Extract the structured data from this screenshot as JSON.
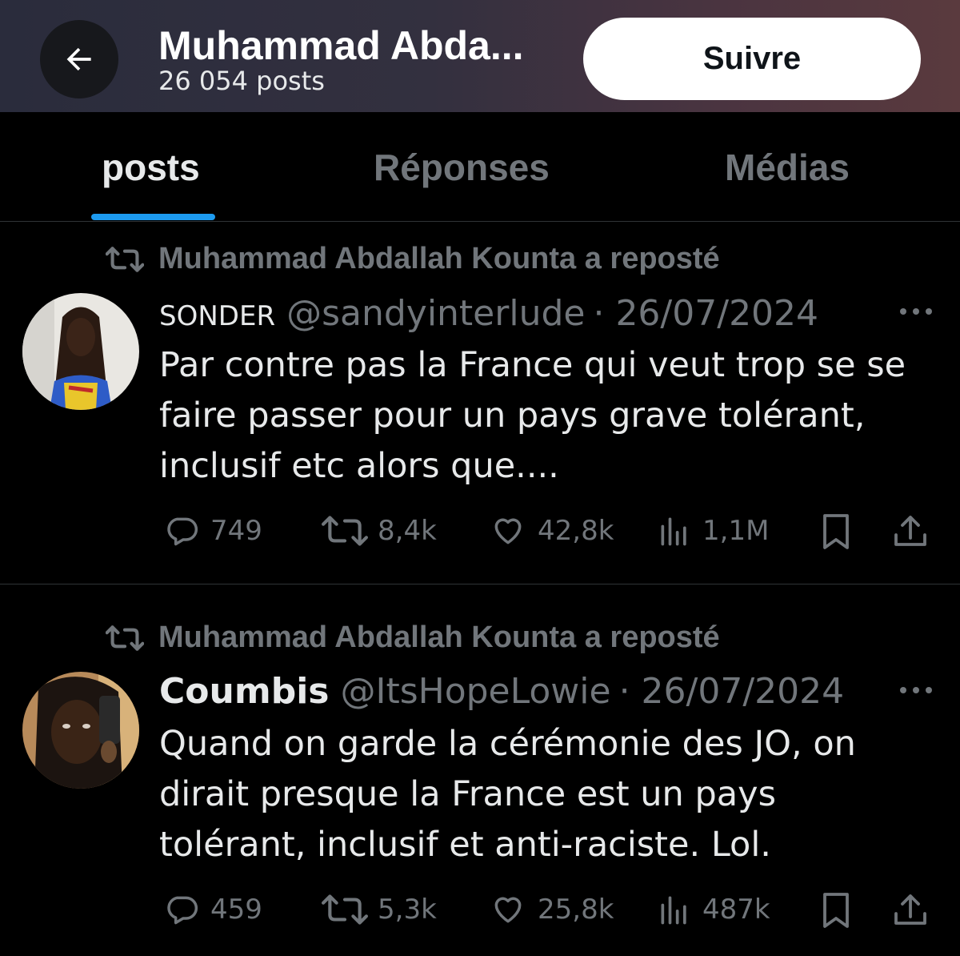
{
  "header": {
    "profile_name": "Muhammad Abda...",
    "post_count": "26 054 posts",
    "follow_label": "Suivre"
  },
  "tabs": [
    {
      "label": "posts",
      "active": true
    },
    {
      "label": "Réponses",
      "active": false
    },
    {
      "label": "Médias",
      "active": false
    }
  ],
  "accent_color": "#1d9bf0",
  "posts": [
    {
      "repost_text": "Muhammad Abdallah Kounta a reposté",
      "author_name": "SONDER",
      "handle": "@sandyinterlude",
      "date": "· 26/07/2024",
      "text_lines": [
        "Par contre pas la France qui veut trop se se",
        "faire passer pour un pays grave tolérant,",
        "inclusif etc alors que...."
      ],
      "replies": "749",
      "reposts": "8,4k",
      "likes": "42,8k",
      "views": "1,1M"
    },
    {
      "repost_text": "Muhammad Abdallah Kounta a reposté",
      "author_name": "Coumbis",
      "handle": "@ItsHopeLowie",
      "date": "· 26/07/2024",
      "text_lines": [
        "Quand on garde la cérémonie des JO, on",
        "dirait presque la France est un pays",
        "tolérant, inclusif et anti-raciste. Lol."
      ],
      "replies": "459",
      "reposts": "5,3k",
      "likes": "25,8k",
      "views": "487k"
    }
  ]
}
